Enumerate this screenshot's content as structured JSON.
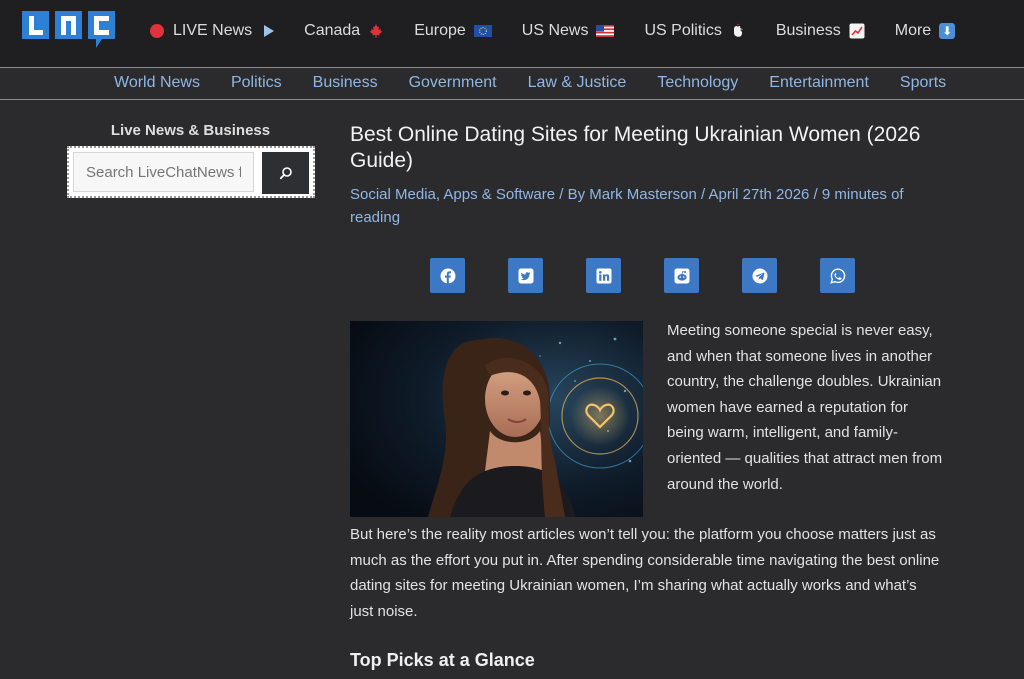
{
  "site": {
    "logo_text": "LNC"
  },
  "top_nav": [
    {
      "label": "LIVE News",
      "icon": "live-dot-icon",
      "trail": "play-icon"
    },
    {
      "label": "Canada",
      "icon": "maple-leaf-icon"
    },
    {
      "label": "Europe",
      "icon": "eu-flag-icon"
    },
    {
      "label": "US News",
      "icon": "us-flag-icon"
    },
    {
      "label": "US Politics",
      "icon": "rooster-icon"
    },
    {
      "label": "Business",
      "icon": "chart-up-icon"
    },
    {
      "label": "More",
      "icon": "down-arrow-icon"
    }
  ],
  "category_nav": [
    "World News",
    "Politics",
    "Business",
    "Government",
    "Law & Justice",
    "Technology",
    "Entertainment",
    "Sports"
  ],
  "sidebar": {
    "title": "Live News & Business",
    "search_placeholder": "Search LiveChatNews f",
    "search_button_icon": "search-icon"
  },
  "article": {
    "title": "Best Online Dating Sites for Meeting Ukrainian Women (2026 Guide)",
    "meta": "Social Media, Apps & Software / By Mark Masterson / April 27th 2026 / 9 minutes of reading",
    "share_icons": [
      "facebook-icon",
      "twitter-icon",
      "linkedin-icon",
      "reddit-icon",
      "telegram-icon",
      "whatsapp-icon"
    ],
    "paragraph1": "Meeting someone special is never easy, and when that someone lives in another country, the challenge doubles. Ukrainian women have earned a reputation for being warm, intelligent, and family-oriented — qualities that attract men from around the world.",
    "paragraph2": "But here’s the reality most articles won’t tell you: the platform you choose matters just as much as the effort you put in. After spending considerable time navigating the best online dating sites for meeting Ukrainian women, I’m sharing what actually works and what’s just noise.",
    "heading": "Top Picks at a Glance"
  },
  "colors": {
    "link": "#8fb7e6",
    "share_button": "#3d78c4",
    "logo_blue": "#2e7fd6"
  }
}
